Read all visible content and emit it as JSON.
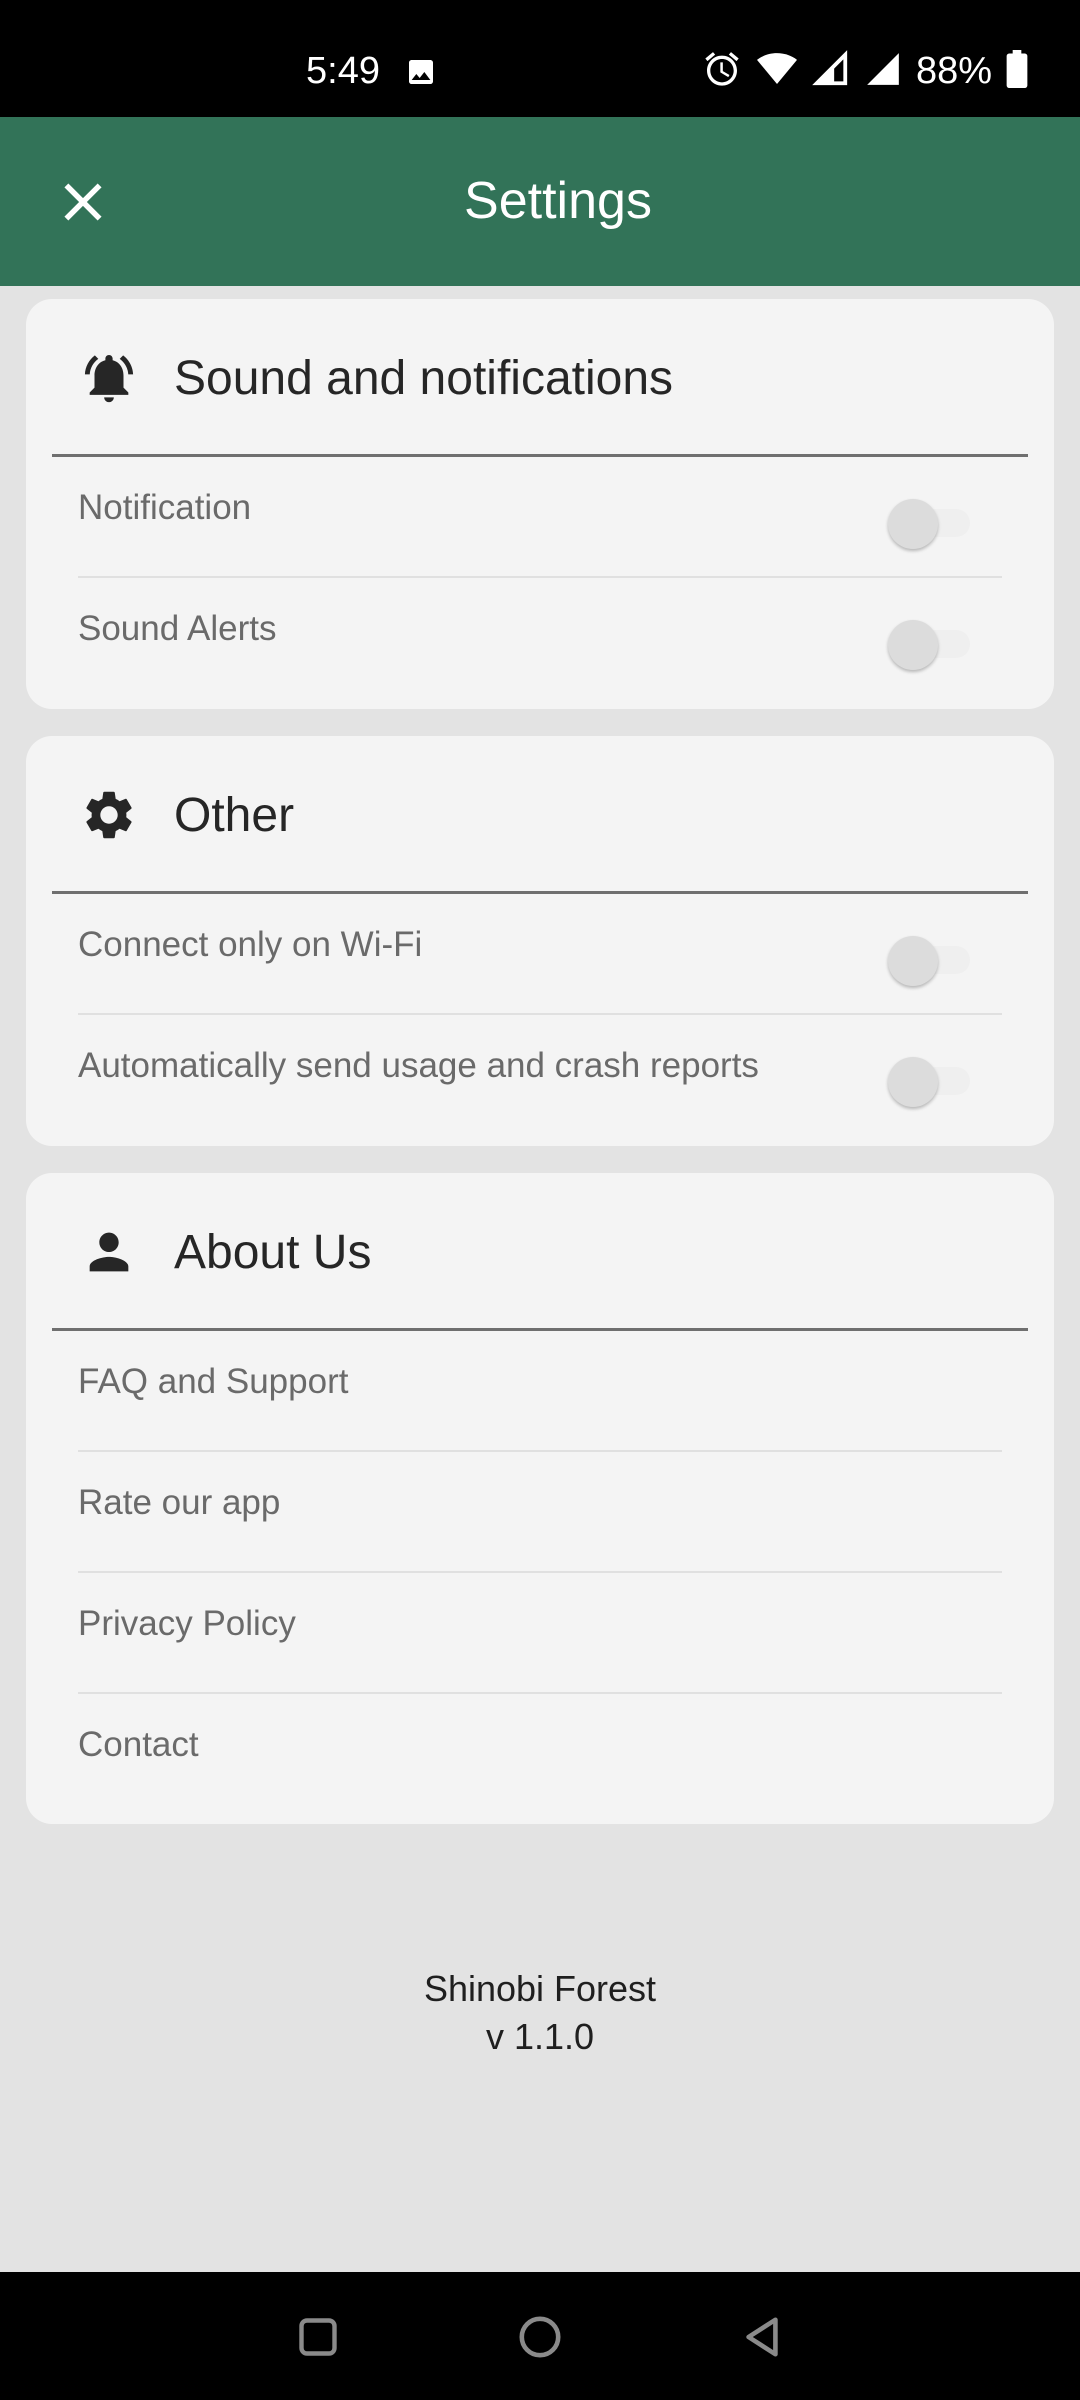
{
  "status_bar": {
    "time": "5:49",
    "battery": "88%",
    "icons": [
      "image-icon",
      "alarm-icon",
      "wifi-icon",
      "signal-icon",
      "signal-icon",
      "battery-icon"
    ]
  },
  "app_bar": {
    "title": "Settings",
    "close_icon": "close-icon",
    "background_color": "#327358"
  },
  "sections": {
    "sound": {
      "title": "Sound and notifications",
      "icon": "bell-icon",
      "items": [
        {
          "label": "Notification",
          "toggle": false
        },
        {
          "label": "Sound Alerts",
          "toggle": false
        }
      ]
    },
    "other": {
      "title": "Other",
      "icon": "gear-icon",
      "items": [
        {
          "label": "Connect only on Wi-Fi",
          "toggle": false
        },
        {
          "label": "Automatically send usage and crash reports",
          "toggle": false
        }
      ]
    },
    "about": {
      "title": "About Us",
      "icon": "person-icon",
      "items": [
        {
          "label": "FAQ and Support"
        },
        {
          "label": "Rate our app"
        },
        {
          "label": "Privacy Policy"
        },
        {
          "label": "Contact"
        }
      ]
    }
  },
  "footer": {
    "app_name": "Shinobi Forest",
    "version": "v 1.1.0"
  },
  "nav_bar": {
    "buttons": [
      "recents-button",
      "home-button",
      "back-button"
    ]
  }
}
